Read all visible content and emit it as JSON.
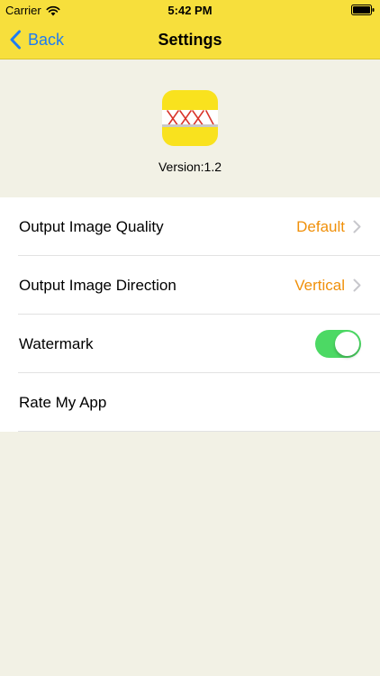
{
  "status_bar": {
    "carrier": "Carrier",
    "time": "5:42 PM"
  },
  "nav": {
    "back_label": "Back",
    "title": "Settings"
  },
  "app": {
    "version": "Version:1.2"
  },
  "settings": [
    {
      "label": "Output Image Quality",
      "value": "Default"
    },
    {
      "label": "Output Image Direction",
      "value": "Vertical"
    },
    {
      "label": "Watermark",
      "toggle_on": true
    },
    {
      "label": "Rate My App"
    }
  ],
  "colors": {
    "nav_background": "#F7DF3C",
    "page_background": "#F2F1E5",
    "accent_blue": "#1E7CF2",
    "value_orange": "#F0900A",
    "toggle_on": "#4CD964"
  }
}
